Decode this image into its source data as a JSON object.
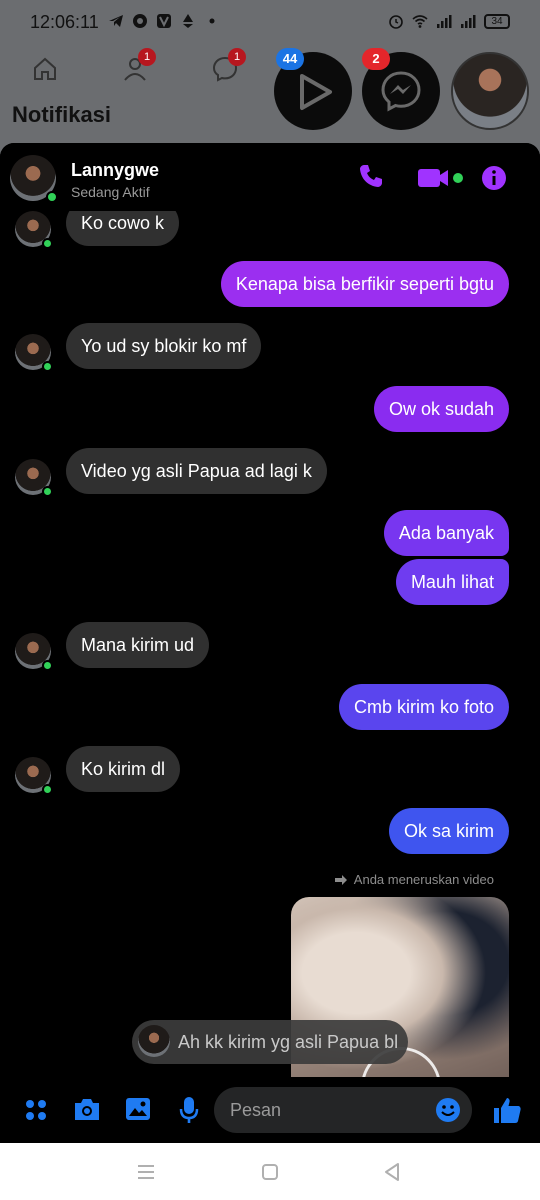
{
  "status_bar": {
    "time": "12:06:11",
    "battery": "34"
  },
  "facebook_bg": {
    "title": "Notifikasi",
    "nav_badges": [
      "1",
      "1"
    ],
    "color_dim": "#6b6d70"
  },
  "chat_heads": {
    "video_badge": "44",
    "messenger_badge": "2",
    "badge_blue": "#1b74e4",
    "badge_red": "#e4262b"
  },
  "chat": {
    "contact_name": "Lannygwe",
    "contact_status": "Sedang Aktif",
    "accent_color": "#a033ff",
    "messages": [
      {
        "from": "them",
        "text": "Ko cowo k"
      },
      {
        "from": "me",
        "text": "Kenapa bisa berfikir seperti bgtu",
        "color": "#9b2ff0"
      },
      {
        "from": "them",
        "text": "Yo ud sy blokir ko mf"
      },
      {
        "from": "me",
        "text": "Ow ok sudah",
        "color": "#8a2cf0"
      },
      {
        "from": "them",
        "text": "Video yg asli Papua ad lagi k"
      },
      {
        "from": "me",
        "text": "Ada banyak",
        "color": "#7836f0"
      },
      {
        "from": "me",
        "text": "Mauh lihat",
        "color": "#6f3cf0"
      },
      {
        "from": "them",
        "text": "Mana kirim ud"
      },
      {
        "from": "me",
        "text": "Cmb kirim ko foto",
        "color": "#5a45ee"
      },
      {
        "from": "them",
        "text": "Ko kirim dl"
      },
      {
        "from": "me",
        "text": "Ok sa kirim",
        "color": "#3f55ef"
      }
    ],
    "forward_note": "Anda meneruskan video",
    "reply_preview": "Ah kk kirim yg asli Papua bl"
  },
  "composer": {
    "placeholder": "Pesan",
    "icon_color": "#1f7bf2"
  },
  "icons": [
    "home-icon",
    "friends-icon",
    "messenger-icon",
    "play-icon",
    "phone-icon",
    "video-call-icon",
    "info-icon",
    "apps-icon",
    "camera-icon",
    "gallery-icon",
    "mic-icon",
    "emoji-icon",
    "like-icon",
    "forward-icon",
    "recent-apps-icon",
    "home-nav-icon",
    "back-icon"
  ]
}
